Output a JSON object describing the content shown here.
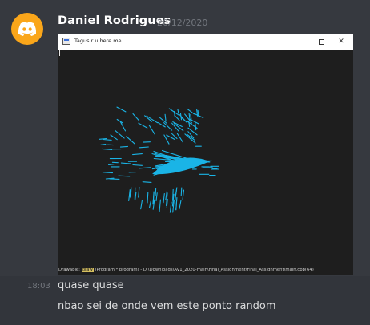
{
  "message": {
    "author": "Daniel Rodrigues",
    "timestamp": "20/12/2020",
    "avatar_color": "#faa61a",
    "avatar_icon": "discord-logo-icon"
  },
  "attachment_window": {
    "title": "Tagus r u here me",
    "controls": [
      "minimize-icon",
      "maximize-icon",
      "close-icon"
    ],
    "status": {
      "prefix": "Drawable: ",
      "highlight": "draw",
      "suffix": " (Program * program) - D:\\Downloads\\AV1_2020-main\\Final_Assignment\\Final_Assignment\\main.cpp(64)"
    },
    "line_color": "#1ab4e6"
  },
  "followups": [
    {
      "time": "18:03",
      "text": "quase quase"
    },
    {
      "time": "",
      "text": "nbao sei de onde vem este ponto random"
    }
  ]
}
